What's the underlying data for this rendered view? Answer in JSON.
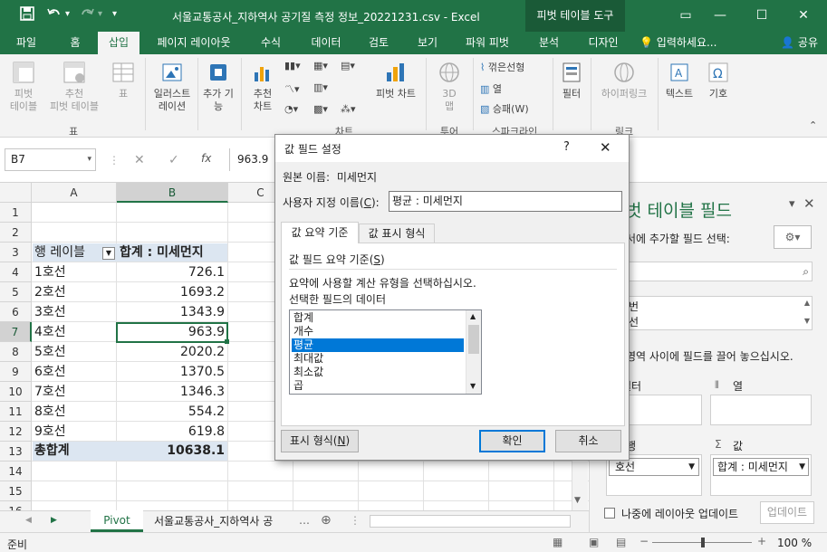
{
  "title_bar": {
    "document_title": "서울교통공사_지하역사 공기질 측정 정보_20221231.csv - Excel",
    "pivot_tool_label": "피벗 테이블 도구",
    "quick_access": {
      "save_icon": "save-icon",
      "undo_icon": "undo-icon",
      "redo_icon": "redo-icon"
    }
  },
  "tabs": [
    {
      "label": "파일"
    },
    {
      "label": "홈"
    },
    {
      "label": "삽입"
    },
    {
      "label": "페이지 레이아웃"
    },
    {
      "label": "수식"
    },
    {
      "label": "데이터"
    },
    {
      "label": "검토"
    },
    {
      "label": "보기"
    },
    {
      "label": "파워 피벗"
    },
    {
      "label": "분석"
    },
    {
      "label": "디자인"
    }
  ],
  "tell_me": "입력하세요...",
  "share": "공유",
  "ribbon": {
    "pivot_table": "피벗\n테이블",
    "rec_pivot": "추천\n피벗 테이블",
    "table": "표",
    "group_table": "표",
    "illustrations": "일러스트\n레이션",
    "addins": "추가 기\n능",
    "rec_charts": "추천\n차트",
    "pivot_chart": "피벗 차트",
    "map3d": "3D\n맵",
    "group_charts": "차트",
    "group_tour": "투어",
    "spark_line": "꺾은선형",
    "spark_column": "열",
    "spark_winloss": "승패(W)",
    "group_sparkline": "스파크라인",
    "filter": "필터",
    "hyperlink": "하이퍼링크",
    "group_link": "링크",
    "text": "텍스트",
    "symbol": "기호"
  },
  "formula_bar": {
    "name_box": "B7",
    "fx": "fx",
    "value": "963.9"
  },
  "sheet": {
    "columns": [
      "A",
      "B",
      "C"
    ],
    "rows": [
      "1",
      "2",
      "3",
      "4",
      "5",
      "6",
      "7",
      "8",
      "9",
      "10",
      "11",
      "12",
      "13",
      "14",
      "15",
      "16"
    ],
    "pivot_header": {
      "row_label": "행 레이블",
      "value_label": "합계 : 미세먼지"
    },
    "pivot_rows": [
      {
        "label": "1호선",
        "value": "726.1"
      },
      {
        "label": "2호선",
        "value": "1693.2"
      },
      {
        "label": "3호선",
        "value": "1343.9"
      },
      {
        "label": "4호선",
        "value": "963.9"
      },
      {
        "label": "5호선",
        "value": "2020.2"
      },
      {
        "label": "6호선",
        "value": "1370.5"
      },
      {
        "label": "7호선",
        "value": "1346.3"
      },
      {
        "label": "8호선",
        "value": "554.2"
      },
      {
        "label": "9호선",
        "value": "619.8"
      }
    ],
    "total": {
      "label": "총합계",
      "value": "10638.1"
    }
  },
  "sheet_tabs": {
    "active": "Pivot",
    "other": "서울교통공사_지하역사 공"
  },
  "status": {
    "ready": "준비",
    "zoom": "100 %"
  },
  "pivot_panel": {
    "title": "벗 테이블 필드",
    "choose_fields": "서에 추가할 필드 선택:",
    "fields": [
      "번",
      "선"
    ],
    "drag_hint": "영역 사이에 필드를 끌어 놓으십시오.",
    "filters_label": "필터",
    "columns_label": "열",
    "rows_label": "행",
    "values_label": "값",
    "rows_value": "호선",
    "values_value": "합계 : 미세먼지",
    "defer_label": "나중에 레이아웃 업데이트",
    "update_button": "업데이트"
  },
  "dialog": {
    "title": "값 필드 설정",
    "help": "?",
    "source_label": "원본 이름:",
    "source_value": "미세먼지",
    "custom_name_label": "사용자 지정 이름(",
    "custom_name_key": "C",
    "custom_name_suffix": "):",
    "custom_name_value": "평균 : 미세먼지",
    "tab_summarize": "값 요약 기준",
    "tab_show_as": "값 표시 형식",
    "summarize_by_label": "값 필드 요약 기준(",
    "summarize_by_key": "S",
    "summarize_by_suffix": ")",
    "instruction": "요약에 사용할 계산 유형을 선택하십시오.",
    "data_label": "선택한 필드의 데이터",
    "list_items": [
      "합계",
      "개수",
      "평균",
      "최대값",
      "최소값",
      "곱"
    ],
    "selected_item": "평균",
    "number_format_button": "표시 형식(",
    "number_format_key": "N",
    "number_format_suffix": ")",
    "ok": "확인",
    "cancel": "취소"
  }
}
